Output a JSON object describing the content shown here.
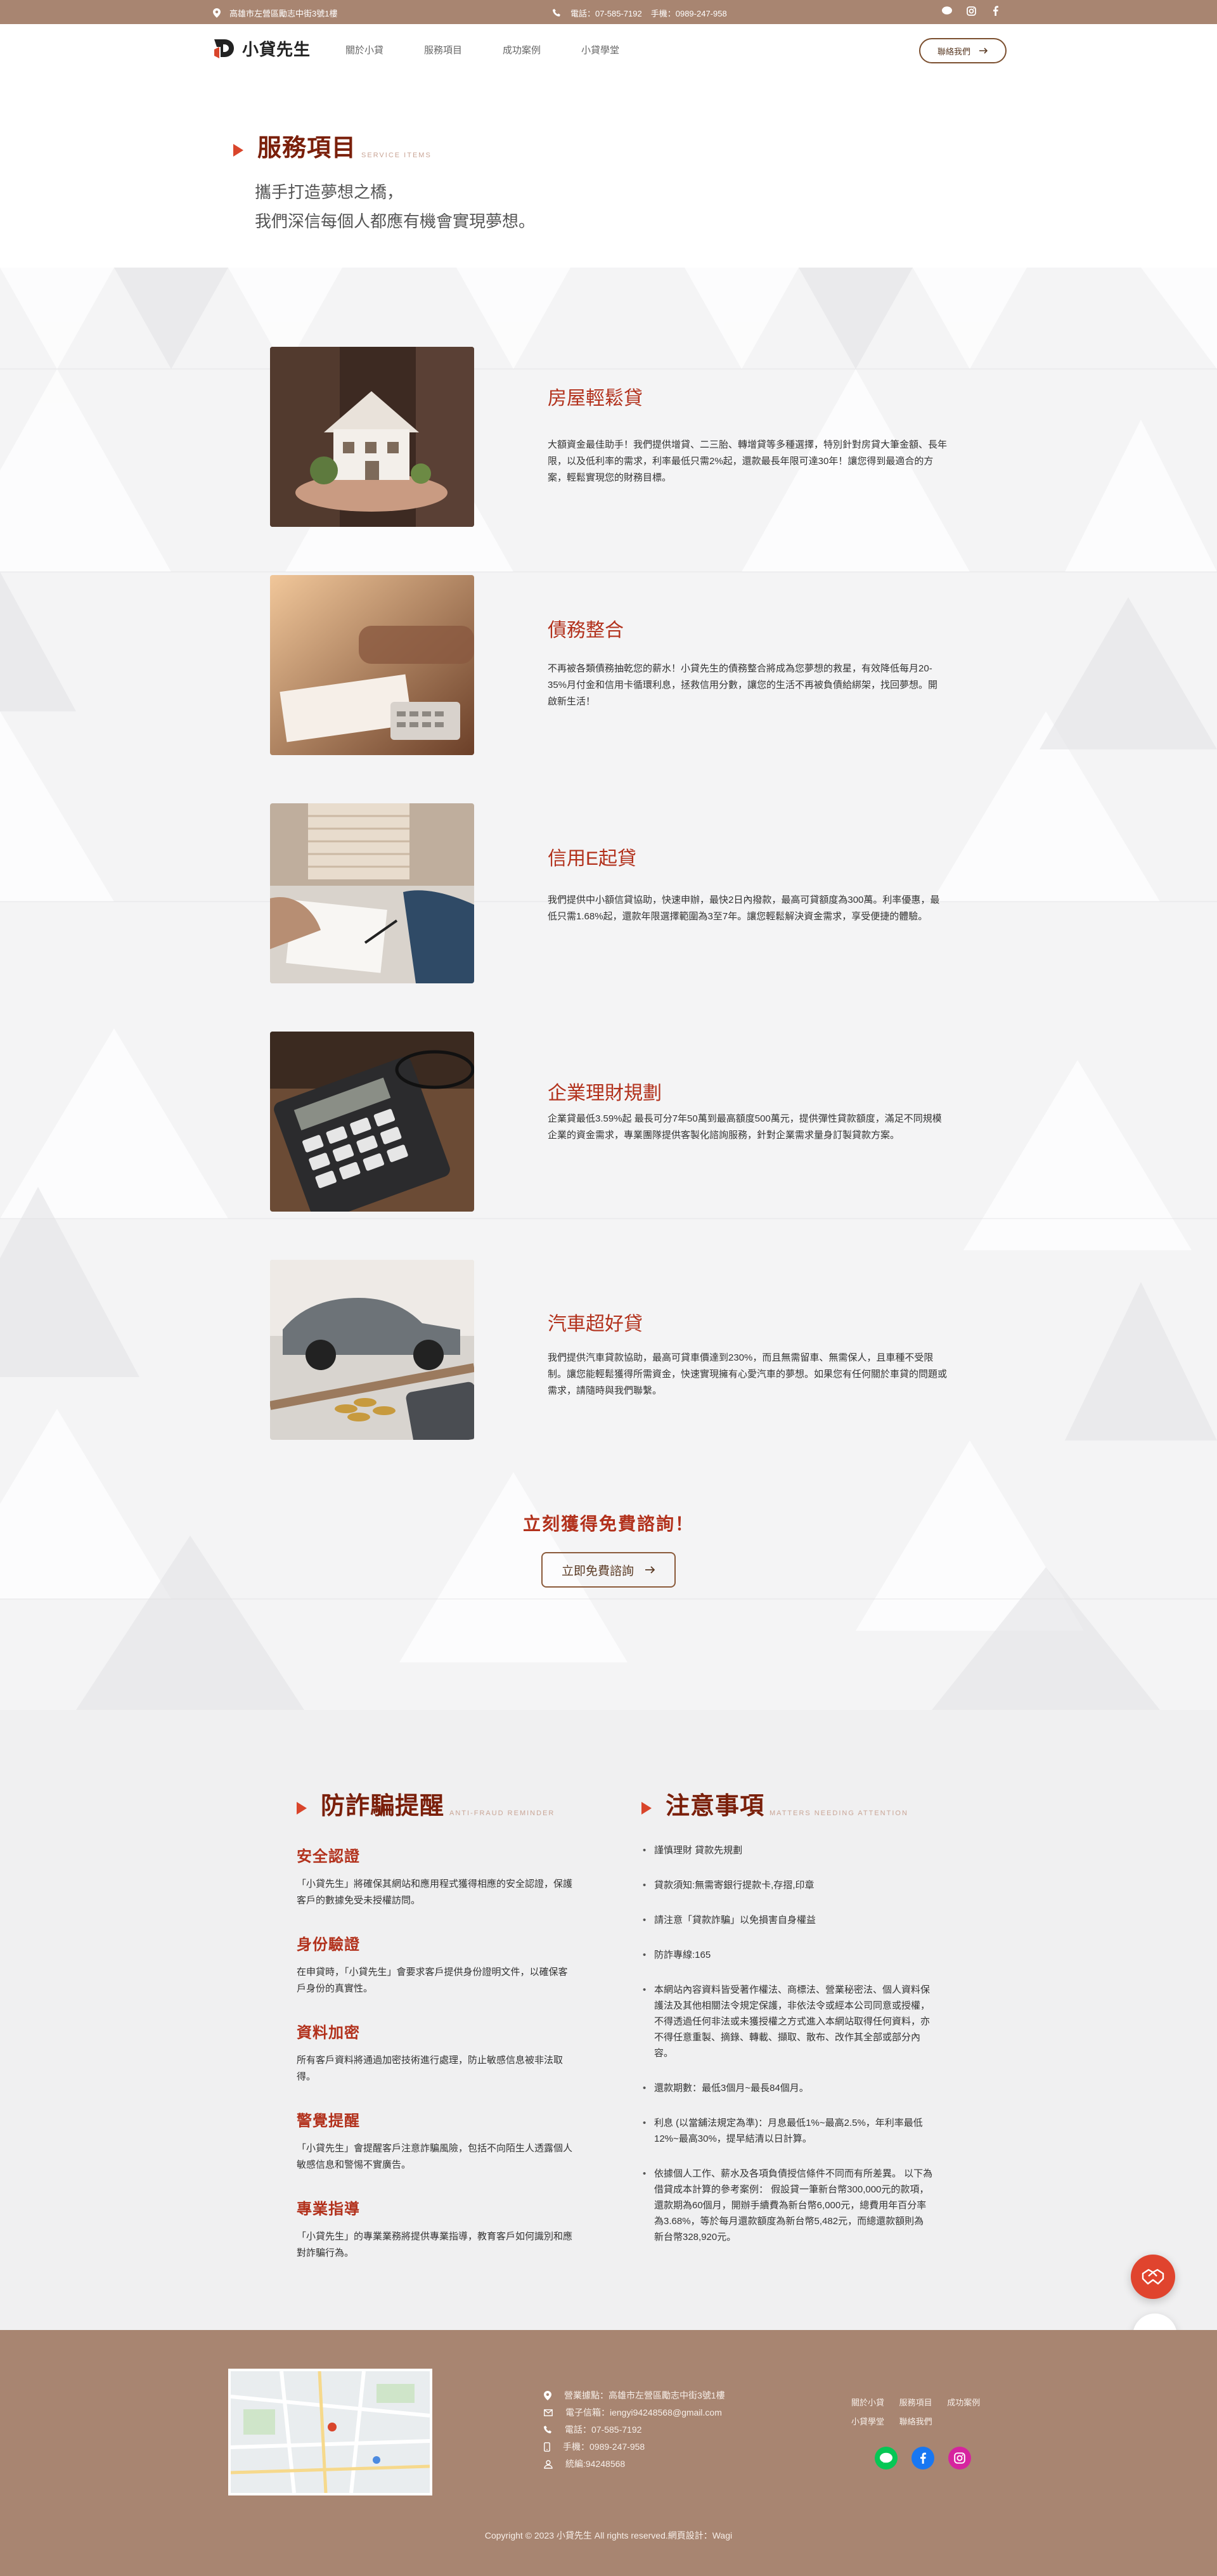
{
  "topbar": {
    "address": "高雄市左營區勵志中街3號1樓",
    "phone": "電話：07-585-7192",
    "mobile": "手機：0989-247-958"
  },
  "header": {
    "logo_text": "小貸先生",
    "nav": [
      "關於小貸",
      "服務項目",
      "成功案例",
      "小貸學堂"
    ],
    "cta_label": "聯絡我們"
  },
  "intro": {
    "title": "服務項目",
    "title_en": "SERVICE ITEMS",
    "slogan_line1": "攜手打造夢想之橋，",
    "slogan_line2": "我們深信每個人都應有機會實現夢想。"
  },
  "services": [
    {
      "title": "房屋輕鬆貸",
      "desc": "大額資金最佳助手！我們提供增貸、二三胎、轉增貸等多種選擇，特別針對房貸大筆金額、長年限，以及低利率的需求，利率最低只需2%起，還款最長年限可達30年！讓您得到最適合的方案，輕鬆實現您的財務目標。"
    },
    {
      "title": "債務整合",
      "desc": "不再被各類債務抽乾您的薪水！小貸先生的債務整合將成為您夢想的救星，有效降低每月20-35%月付金和信用卡循環利息，拯救信用分數，讓您的生活不再被負債給綁架，找回夢想。開啟新生活！"
    },
    {
      "title": "信用E起貸",
      "desc": "我們提供中小額信貸協助，快速申辦，最快2日內撥款，最高可貸額度為300萬。利率優惠，最低只需1.68%起，還款年限選擇範圍為3至7年。讓您輕鬆解決資金需求，享受便捷的體驗。"
    },
    {
      "title": "企業理財規劃",
      "desc": "企業貸最低3.59%起 最長可分7年50萬到最高額度500萬元，提供彈性貸款額度，滿足不同規模企業的資金需求，專業團隊提供客製化諮詢服務，針對企業需求量身訂製貸款方案。"
    },
    {
      "title": "汽車超好貸",
      "desc": "我們提供汽車貸款協助，最高可貸車價達到230%，而且無需留車、無需保人，且車種不受限制。讓您能輕鬆獲得所需資金，快速實現擁有心愛汽車的夢想。如果您有任何關於車貸的問題或需求，請隨時與我們聯繫。"
    }
  ],
  "cta": {
    "heading": "立刻獲得免費諮詢！",
    "button": "立即免費諮詢"
  },
  "fraud": {
    "title": "防詐騙提醒",
    "title_en": "ANTI-FRAUD REMINDER",
    "items": [
      {
        "h": "安全認證",
        "p": "「小貸先生」將確保其網站和應用程式獲得相應的安全認證，保護客戶的數據免受未授權訪問。"
      },
      {
        "h": "身份驗證",
        "p": "在申貸時，「小貸先生」會要求客戶提供身份證明文件，以確保客戶身份的真實性。"
      },
      {
        "h": "資料加密",
        "p": "所有客戶資料將通過加密技術進行處理，防止敏感信息被非法取得。"
      },
      {
        "h": "警覺提醒",
        "p": "「小貸先生」會提醒客戶注意詐騙風險，包括不向陌生人透露個人敏感信息和警惕不實廣告。"
      },
      {
        "h": "專業指導",
        "p": "「小貸先生」的專業業務將提供專業指導，教育客戶如何識別和應對詐騙行為。"
      }
    ]
  },
  "notes": {
    "title": "注意事項",
    "title_en": "MATTERS NEEDING ATTENTION",
    "items": [
      "謹慎理財 貸款先規劃",
      "貸款須知:無需寄銀行提款卡,存摺,印章",
      "請注意「貸款詐騙」以免損害自身權益",
      "防詐專線:165",
      "本網站內容資料皆受著作權法、商標法、營業秘密法、個人資料保護法及其他相關法令規定保護，非依法令或經本公司同意或授權，不得透過任何非法或未獲授權之方式進入本網站取得任何資料，亦不得任意重製、摘錄、轉載、擷取、散布、改作其全部或部分內容。",
      "還款期數：最低3個月~最長84個月。",
      "利息 (以當舖法規定為準)：月息最低1%~最高2.5%，年利率最低12%~最高30%，提早結清以日計算。",
      "依據個人工作、薪水及各項負債授信條件不同而有所差異。 以下為借貸成本計算的參考案例： 假設貸一筆新台幣300,000元的款項，還款期為60個月，開辦手續費為新台幣6,000元，總費用年百分率為3.68%，等於每月還款額度為新台幣5,482元，而總還款額則為新台幣328,920元。"
    ]
  },
  "footer": {
    "address": "營業據點：高雄市左營區勵志中街3號1樓",
    "email": "電子信箱：iengyi94248568@gmail.com",
    "phone": "電話：07-585-7192",
    "mobile": "手機：0989-247-958",
    "tax_id": "統編:94248568",
    "links_row1": [
      "關於小貸",
      "服務項目",
      "成功案例"
    ],
    "links_row2": [
      "小貸學堂",
      "聯絡我們"
    ],
    "copyright": "Copyright © 2023 小貸先生 All rights reserved.網頁設計：Wagi"
  },
  "colors": {
    "brand_brown": "#a88571",
    "accent_red": "#b2311c",
    "triangle_red": "#d9452b"
  }
}
